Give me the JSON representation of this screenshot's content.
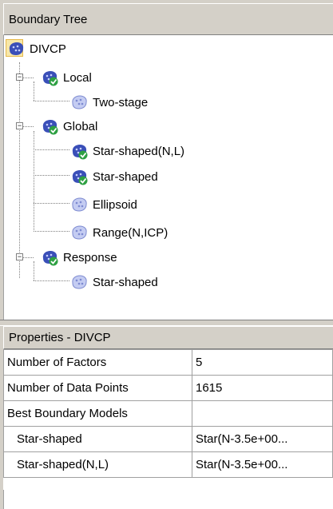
{
  "boundary_tree": {
    "header": "Boundary Tree",
    "root": {
      "label": "DIVCP",
      "icon": "boundary-model-icon"
    },
    "nodes": [
      {
        "label": "Local",
        "icon": "boundary-model-checked-icon",
        "expanded": true
      },
      {
        "label": "Two-stage",
        "icon": "boundary-model-faded-icon"
      },
      {
        "label": "Global",
        "icon": "boundary-model-checked-icon",
        "expanded": true
      },
      {
        "label": "Star-shaped(N,L)",
        "icon": "boundary-model-checked-icon"
      },
      {
        "label": "Star-shaped",
        "icon": "boundary-model-checked-icon"
      },
      {
        "label": "Ellipsoid",
        "icon": "boundary-model-faded-icon"
      },
      {
        "label": "Range(N,ICP)",
        "icon": "boundary-model-faded-icon"
      },
      {
        "label": "Response",
        "icon": "boundary-model-checked-icon",
        "expanded": true
      },
      {
        "label": "Star-shaped",
        "icon": "boundary-model-faded-icon"
      }
    ],
    "toggle_symbol": "−"
  },
  "properties": {
    "header": "Properties - DIVCP",
    "rows": [
      {
        "name": "Number of Factors",
        "value": "5"
      },
      {
        "name": "Number of Data Points",
        "value": "1615"
      },
      {
        "name": "Best Boundary Models",
        "value": ""
      },
      {
        "name": "Star-shaped",
        "value": "Star(N-3.5e+00..."
      },
      {
        "name": "Star-shaped(N,L)",
        "value": "Star(N-3.5e+00..."
      }
    ]
  },
  "colors": {
    "chrome": "#d4d0c8",
    "icon_blue": "#3a4fb8",
    "icon_faded": "#a8b4e8",
    "check_green": "#2ea043",
    "root_highlight": "#f7e7a8"
  }
}
